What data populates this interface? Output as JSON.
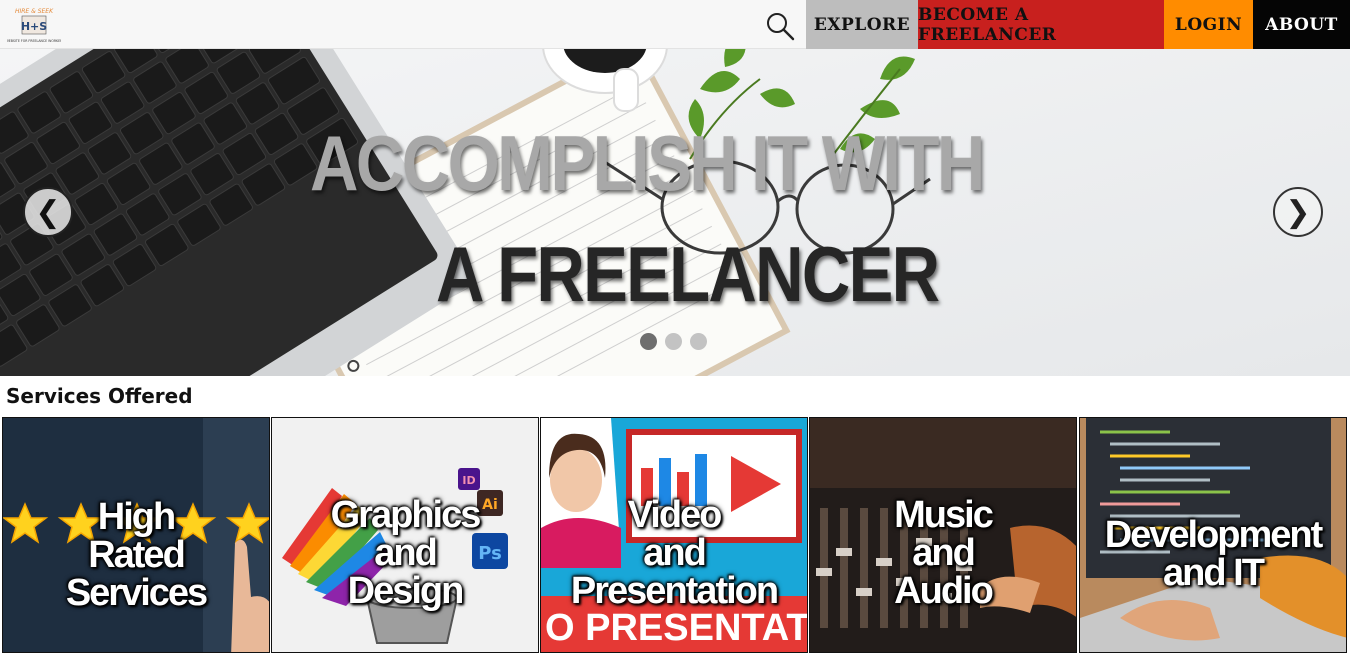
{
  "nav": {
    "logo_text": "HIRE & SEEK",
    "logo_subtitle": "WEBSITE FOR FREELANCE WORKER",
    "items": [
      {
        "label": "EXPLORE"
      },
      {
        "label": "BECOME A FREELANCER"
      },
      {
        "label": "LOGIN"
      },
      {
        "label": "ABOUT"
      }
    ],
    "search_icon": "search-icon"
  },
  "hero": {
    "headline_line1": "ACCOMPLISH IT WITH",
    "headline_line2": "A FREELANCER",
    "prev_arrow": "❮",
    "next_arrow": "❯",
    "slide_count": 3,
    "active_slide": 1
  },
  "services": {
    "title": "Services Offered",
    "cards": [
      {
        "label": "High\nRated\nServices"
      },
      {
        "label": "Graphics\nand\nDesign"
      },
      {
        "label": "Video\nand\nPresentation"
      },
      {
        "label": "Music\nand\nAudio"
      },
      {
        "label": "Development\nand IT"
      }
    ],
    "video_banner_text": "O PRESENTAT"
  },
  "colors": {
    "explore_bg": "#bdbdbd",
    "freelancer_bg": "#c8201e",
    "login_bg": "#ff8c00",
    "about_bg": "#050505"
  }
}
